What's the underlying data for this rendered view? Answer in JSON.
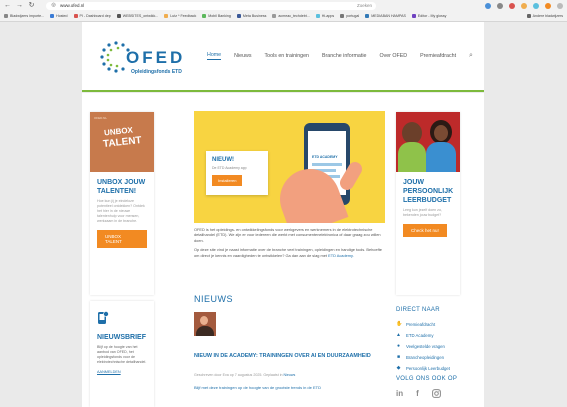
{
  "browser": {
    "url": "www.ofed.nl",
    "search_placeholder": "Zoeken",
    "bookmarks": [
      "Bladwijzers importe...",
      "Hosted",
      "PI - Dashboard dep",
      "WEBSITES_ontwikk...",
      "Lutz * Feedback",
      "Mobil Banking",
      "Meta Business",
      "acmeac_techdebt...",
      "Hi-apps",
      "portugal",
      "MEDIABAN HAMPAS",
      "Editor - My glossy",
      "Andere bladwijzers"
    ],
    "bookmark_colors": [
      "#888888",
      "#3a7bd5",
      "#d9534f",
      "#555555",
      "#f0ad4e",
      "#5cb85c",
      "#3b5998",
      "#999999",
      "#5bc0de",
      "#777777",
      "#337ab7",
      "#6f42c1",
      "#666666"
    ]
  },
  "logo": {
    "word": "OFED",
    "sub": "Opleidingsfonds ETD"
  },
  "nav": [
    "Home",
    "Nieuws",
    "Tools en trainingen",
    "Branche informatie",
    "Over OFED",
    "Premieafdracht"
  ],
  "unbox": {
    "image_small": "OFED.NL",
    "image_line1": "UNBOX",
    "image_line2": "TALENT",
    "title": "UNBOX JOUW TALENTEN!",
    "text": "Hoe kun jij je eindeloze potentieel ontdekken? Ontdek het hier in de nieuwe talentenhulp voor mensen, werkzaam in de branche.",
    "button": "UNBOX TALENT"
  },
  "newsletter": {
    "title": "NIEUWSBRIEF",
    "text": "Blijf op de hoogte van het aanbod van OFED, het opleidingsfonds voor de elektrotechnische detailhandel.",
    "link": "AANMELDEN"
  },
  "banner": {
    "badge_title": "NIEUW!",
    "badge_sub": "De ETD Academy app",
    "button": "Installeren",
    "phone_text": "ETD ACADEMY"
  },
  "intro": {
    "p1": "OFED is het opleidings- en ontwikkelingsfonds voor werkgevers en werknemers in de elektrotechnische detailhandel (ETD). We zijn er voor iedereen die werkt met consumentenelektronica of daar graag zou willen doen.",
    "p2_start": "Op deze site vind je naast informatie over de branche veel trainingen, opleidingen en handige tools. Behoefte om direct je kennis en vaardigheden te ontwikkelen? Ga dan aan de slag met ",
    "p2_link": "ETD Academy."
  },
  "news": {
    "heading": "NIEUWS",
    "article_title": "NIEUW IN DE ACADEMY: TRAININGEN OVER AI EN DUURZAAMHEID",
    "meta_prefix": "Geschreven door Eva op 7 augustus 2025. Geplaatst in ",
    "meta_category": "Nieuws",
    "link": "Blijf met deze trainingen op de hoogte van de grootste trends in de ETD"
  },
  "budget": {
    "title": "JOUW PERSOONLIJK LEERBUDGET",
    "text": "Leeg kun jezelf doen zo, bekenden jouw budget?",
    "button": "Check het nu!"
  },
  "direct": {
    "title": "DIRECT NAAR",
    "items": [
      {
        "label": "Premieafdracht",
        "icon": "hand-coin-icon"
      },
      {
        "label": "ETD Academy",
        "icon": "graduation-cap-icon"
      },
      {
        "label": "Veelgestelde vragen",
        "icon": "info-icon"
      },
      {
        "label": "Brancheopleidingen",
        "icon": "book-icon"
      },
      {
        "label": "Persoonlijk Leerbudget",
        "icon": "handshake-icon"
      }
    ]
  },
  "follow": {
    "title": "VOLG ONS OOK OP",
    "networks": [
      "in",
      "f",
      "ig"
    ]
  },
  "colors": {
    "brand_blue": "#1e6fa9",
    "accent_green": "#7dba3c",
    "cta_orange": "#f28a22",
    "banner_yellow": "#f8d441"
  }
}
